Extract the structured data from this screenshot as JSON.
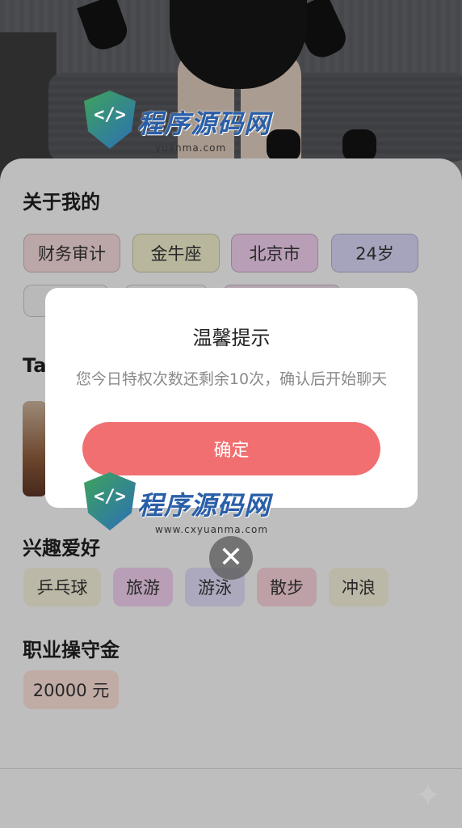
{
  "about": {
    "title": "关于我的",
    "chips": [
      "财务审计",
      "金牛座",
      "北京市",
      "24岁"
    ]
  },
  "tags_section": {
    "title_partial": "Ta"
  },
  "hobbies": {
    "title": "兴趣爱好",
    "chips": [
      "乒乓球",
      "旅游",
      "游泳",
      "散步",
      "冲浪"
    ]
  },
  "deposit": {
    "title": "职业操守金",
    "value": "20000 元"
  },
  "dialog": {
    "title": "温馨提示",
    "message": "您今日特权次数还剩余10次，确认后开始聊天",
    "confirm_label": "确定",
    "close_icon": "close-icon"
  },
  "watermark": {
    "brand": "程序源码网",
    "domain_top": "yuanma.com",
    "domain_bottom": "www.cxyuanma.com",
    "logo_glyph": "</>"
  },
  "colors": {
    "confirm_button": "#f16f70",
    "watermark_text": "#2a5fa8"
  },
  "icons": {
    "sparkle": "sparkle-icon"
  }
}
